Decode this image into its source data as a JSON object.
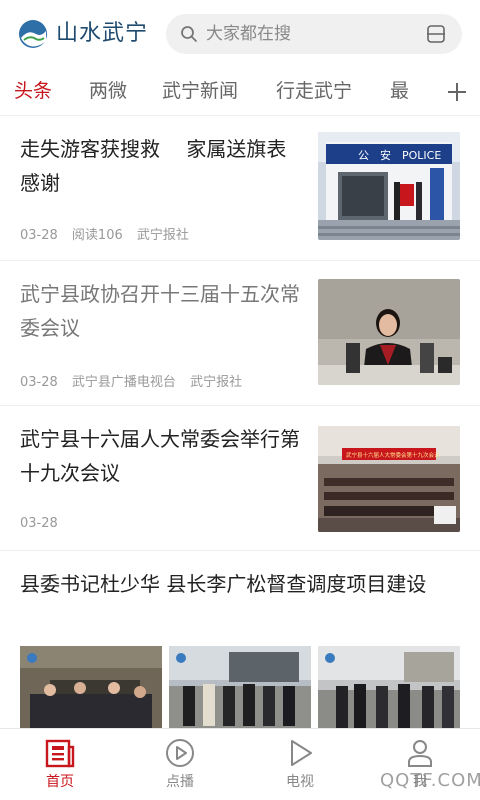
{
  "header": {
    "app_name": "山水武宁",
    "search_placeholder": "大家都在搜",
    "logo_icon": "wuning-logo-icon",
    "search_icon": "search-icon",
    "scan_icon": "scan-icon"
  },
  "tabs": [
    "头条",
    "两微",
    "武宁新闻",
    "行走武宁",
    "最"
  ],
  "active_tab": "头条",
  "news": [
    {
      "title": "走失游客获搜救　 家属送旗表感谢",
      "meta": [
        "03-28",
        "阅读106",
        "武宁报社"
      ],
      "read": false
    },
    {
      "title": "武宁县政协召开十三届十五次常委会议",
      "meta": [
        "03-28",
        "武宁县广播电视台",
        "武宁报社"
      ],
      "read": true
    },
    {
      "title": "武宁县十六届人大常委会举行第十九次会议",
      "meta": [
        "03-28"
      ],
      "read": false
    },
    {
      "title": "县委书记杜少华 县长李广松督查调度项目建设"
    }
  ],
  "photo_text": {
    "police_sign": "公　安　POLICE",
    "meeting_banner": "武宁县十六届人大常委会第十九次会议"
  },
  "bottom_nav": [
    {
      "label": "首页",
      "icon": "news-home-icon",
      "active": true
    },
    {
      "label": "点播",
      "icon": "play-circle-icon",
      "active": false
    },
    {
      "label": "电视",
      "icon": "tv-play-icon",
      "active": false
    },
    {
      "label": "我",
      "icon": "user-icon",
      "active": false
    }
  ],
  "colors": {
    "accent": "#c8161d",
    "brand": "#1f4a6e"
  },
  "watermark": "QQTF.COM"
}
